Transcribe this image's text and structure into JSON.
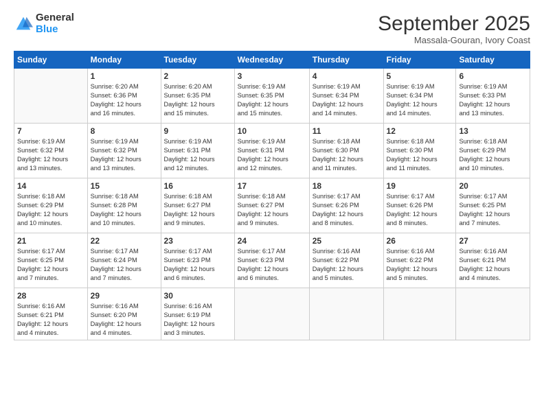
{
  "logo": {
    "general": "General",
    "blue": "Blue"
  },
  "title": "September 2025",
  "subtitle": "Massala-Gouran, Ivory Coast",
  "days": [
    "Sunday",
    "Monday",
    "Tuesday",
    "Wednesday",
    "Thursday",
    "Friday",
    "Saturday"
  ],
  "weeks": [
    [
      {
        "num": "",
        "info": ""
      },
      {
        "num": "1",
        "info": "Sunrise: 6:20 AM\nSunset: 6:36 PM\nDaylight: 12 hours\nand 16 minutes."
      },
      {
        "num": "2",
        "info": "Sunrise: 6:20 AM\nSunset: 6:35 PM\nDaylight: 12 hours\nand 15 minutes."
      },
      {
        "num": "3",
        "info": "Sunrise: 6:19 AM\nSunset: 6:35 PM\nDaylight: 12 hours\nand 15 minutes."
      },
      {
        "num": "4",
        "info": "Sunrise: 6:19 AM\nSunset: 6:34 PM\nDaylight: 12 hours\nand 14 minutes."
      },
      {
        "num": "5",
        "info": "Sunrise: 6:19 AM\nSunset: 6:34 PM\nDaylight: 12 hours\nand 14 minutes."
      },
      {
        "num": "6",
        "info": "Sunrise: 6:19 AM\nSunset: 6:33 PM\nDaylight: 12 hours\nand 13 minutes."
      }
    ],
    [
      {
        "num": "7",
        "info": "Sunrise: 6:19 AM\nSunset: 6:32 PM\nDaylight: 12 hours\nand 13 minutes."
      },
      {
        "num": "8",
        "info": "Sunrise: 6:19 AM\nSunset: 6:32 PM\nDaylight: 12 hours\nand 13 minutes."
      },
      {
        "num": "9",
        "info": "Sunrise: 6:19 AM\nSunset: 6:31 PM\nDaylight: 12 hours\nand 12 minutes."
      },
      {
        "num": "10",
        "info": "Sunrise: 6:19 AM\nSunset: 6:31 PM\nDaylight: 12 hours\nand 12 minutes."
      },
      {
        "num": "11",
        "info": "Sunrise: 6:18 AM\nSunset: 6:30 PM\nDaylight: 12 hours\nand 11 minutes."
      },
      {
        "num": "12",
        "info": "Sunrise: 6:18 AM\nSunset: 6:30 PM\nDaylight: 12 hours\nand 11 minutes."
      },
      {
        "num": "13",
        "info": "Sunrise: 6:18 AM\nSunset: 6:29 PM\nDaylight: 12 hours\nand 10 minutes."
      }
    ],
    [
      {
        "num": "14",
        "info": "Sunrise: 6:18 AM\nSunset: 6:29 PM\nDaylight: 12 hours\nand 10 minutes."
      },
      {
        "num": "15",
        "info": "Sunrise: 6:18 AM\nSunset: 6:28 PM\nDaylight: 12 hours\nand 10 minutes."
      },
      {
        "num": "16",
        "info": "Sunrise: 6:18 AM\nSunset: 6:27 PM\nDaylight: 12 hours\nand 9 minutes."
      },
      {
        "num": "17",
        "info": "Sunrise: 6:18 AM\nSunset: 6:27 PM\nDaylight: 12 hours\nand 9 minutes."
      },
      {
        "num": "18",
        "info": "Sunrise: 6:17 AM\nSunset: 6:26 PM\nDaylight: 12 hours\nand 8 minutes."
      },
      {
        "num": "19",
        "info": "Sunrise: 6:17 AM\nSunset: 6:26 PM\nDaylight: 12 hours\nand 8 minutes."
      },
      {
        "num": "20",
        "info": "Sunrise: 6:17 AM\nSunset: 6:25 PM\nDaylight: 12 hours\nand 7 minutes."
      }
    ],
    [
      {
        "num": "21",
        "info": "Sunrise: 6:17 AM\nSunset: 6:25 PM\nDaylight: 12 hours\nand 7 minutes."
      },
      {
        "num": "22",
        "info": "Sunrise: 6:17 AM\nSunset: 6:24 PM\nDaylight: 12 hours\nand 7 minutes."
      },
      {
        "num": "23",
        "info": "Sunrise: 6:17 AM\nSunset: 6:23 PM\nDaylight: 12 hours\nand 6 minutes."
      },
      {
        "num": "24",
        "info": "Sunrise: 6:17 AM\nSunset: 6:23 PM\nDaylight: 12 hours\nand 6 minutes."
      },
      {
        "num": "25",
        "info": "Sunrise: 6:16 AM\nSunset: 6:22 PM\nDaylight: 12 hours\nand 5 minutes."
      },
      {
        "num": "26",
        "info": "Sunrise: 6:16 AM\nSunset: 6:22 PM\nDaylight: 12 hours\nand 5 minutes."
      },
      {
        "num": "27",
        "info": "Sunrise: 6:16 AM\nSunset: 6:21 PM\nDaylight: 12 hours\nand 4 minutes."
      }
    ],
    [
      {
        "num": "28",
        "info": "Sunrise: 6:16 AM\nSunset: 6:21 PM\nDaylight: 12 hours\nand 4 minutes."
      },
      {
        "num": "29",
        "info": "Sunrise: 6:16 AM\nSunset: 6:20 PM\nDaylight: 12 hours\nand 4 minutes."
      },
      {
        "num": "30",
        "info": "Sunrise: 6:16 AM\nSunset: 6:19 PM\nDaylight: 12 hours\nand 3 minutes."
      },
      {
        "num": "",
        "info": ""
      },
      {
        "num": "",
        "info": ""
      },
      {
        "num": "",
        "info": ""
      },
      {
        "num": "",
        "info": ""
      }
    ]
  ]
}
